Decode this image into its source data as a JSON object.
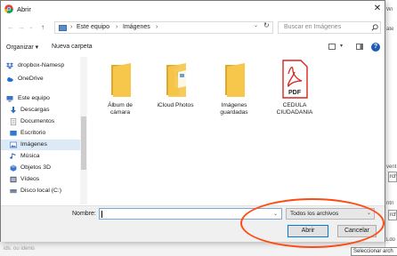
{
  "background": {
    "right_top": "Wi",
    "right_top2": "ate",
    "right_frags": [
      "vent",
      "rch",
      "ntn",
      "rch",
      "Ldo"
    ],
    "bottom_text": "ids. ou idenis",
    "tooltip": "Seleccionar arch"
  },
  "dialog": {
    "title": "Abrir",
    "close_label": "✕"
  },
  "nav": {
    "back": "←",
    "forward": "→",
    "recent": "⌄",
    "up": "↑",
    "breadcrumbs": [
      "Este equipo",
      "Imágenes"
    ],
    "separator": "›",
    "dropdown": "⌄",
    "refresh": "↻"
  },
  "search": {
    "placeholder": "Buscar en Imágenes"
  },
  "toolbar": {
    "organize": "Organizar ▾",
    "new_folder": "Nueva carpeta",
    "view_drop": "▾",
    "help": "?"
  },
  "sidebar": {
    "items": [
      {
        "label": "dropbox-Namesp",
        "icon": "dropbox-icon",
        "color": "#3d6fc7"
      },
      {
        "label": "OneDrive",
        "icon": "onedrive-icon",
        "color": "#1e6fd0"
      },
      {
        "label": "Este equipo",
        "icon": "computer-icon",
        "color": "#3d74c6"
      },
      {
        "label": "Descargas",
        "icon": "download-icon",
        "color": "#2b6fc4"
      },
      {
        "label": "Documentos",
        "icon": "documents-icon",
        "color": "#8b8b8b"
      },
      {
        "label": "Escritorio",
        "icon": "desktop-icon",
        "color": "#2f7ad0"
      },
      {
        "label": "Imágenes",
        "icon": "pictures-icon",
        "color": "#3d74c6"
      },
      {
        "label": "Música",
        "icon": "music-icon",
        "color": "#2b6fc4"
      },
      {
        "label": "Objetos 3D",
        "icon": "3d-objects-icon",
        "color": "#3d74c6"
      },
      {
        "label": "Vídeos",
        "icon": "videos-icon",
        "color": "#555555"
      },
      {
        "label": "Disco local (C:)",
        "icon": "drive-icon",
        "color": "#666666"
      }
    ]
  },
  "files": [
    {
      "name": "Álbum de cámara",
      "line1": "Álbum de",
      "line2": "cámara",
      "icon": "folder-icon"
    },
    {
      "name": "iCloud Photos",
      "line1": "iCloud Photos",
      "line2": "",
      "icon": "folder-icon"
    },
    {
      "name": "Imágenes guardadas",
      "line1": "Imágenes",
      "line2": "guardadas",
      "icon": "folder-icon"
    },
    {
      "name": "CEDULA CIUDADANIA",
      "line1": "CEDULA",
      "line2": "CIUDADANIA",
      "icon": "pdf-icon",
      "badge": "PDF"
    }
  ],
  "bottom": {
    "name_label": "Nombre:",
    "name_value": "",
    "filter": "Todos los archivos",
    "open_label": "Abrir",
    "cancel_label": "Cancelar"
  },
  "colors": {
    "folder": "#f6c74b",
    "folder_dark": "#e0a82a",
    "pdf_red": "#d7261e",
    "highlight": "#ff4a12",
    "selected": "#dceaf8"
  }
}
